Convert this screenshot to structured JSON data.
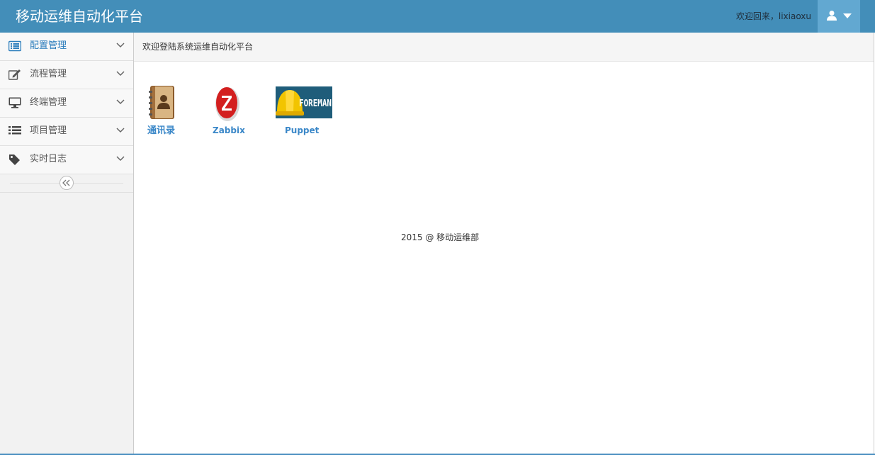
{
  "header": {
    "brand": "移动运维自动化平台",
    "welcome": "欢迎回来，lixiaoxu",
    "user_menu_icon": "user-icon"
  },
  "sidebar": {
    "items": [
      {
        "label": "配置管理",
        "icon": "list-alt-icon",
        "active": true
      },
      {
        "label": "流程管理",
        "icon": "edit-icon",
        "active": false
      },
      {
        "label": "终端管理",
        "icon": "desktop-icon",
        "active": false
      },
      {
        "label": "项目管理",
        "icon": "list-icon",
        "active": false
      },
      {
        "label": "实时日志",
        "icon": "tag-icon",
        "active": false
      }
    ],
    "collapse_icon": "double-angle-left-icon"
  },
  "breadcrumb": {
    "text": "欢迎登陆系统运维自动化平台"
  },
  "apps": [
    {
      "label": "通讯录",
      "icon": "address-book-icon"
    },
    {
      "label": "Zabbix",
      "icon": "zabbix-logo"
    },
    {
      "label": "Puppet",
      "icon": "foreman-logo",
      "logo_text": "FOREMAN"
    }
  ],
  "footer": {
    "text": "2015 @ 移动运维部"
  },
  "colors": {
    "topbar": "#438eb9",
    "user_button": "#62a8d1",
    "link": "#3a87c8",
    "active_nav": "#2b7dbc"
  }
}
